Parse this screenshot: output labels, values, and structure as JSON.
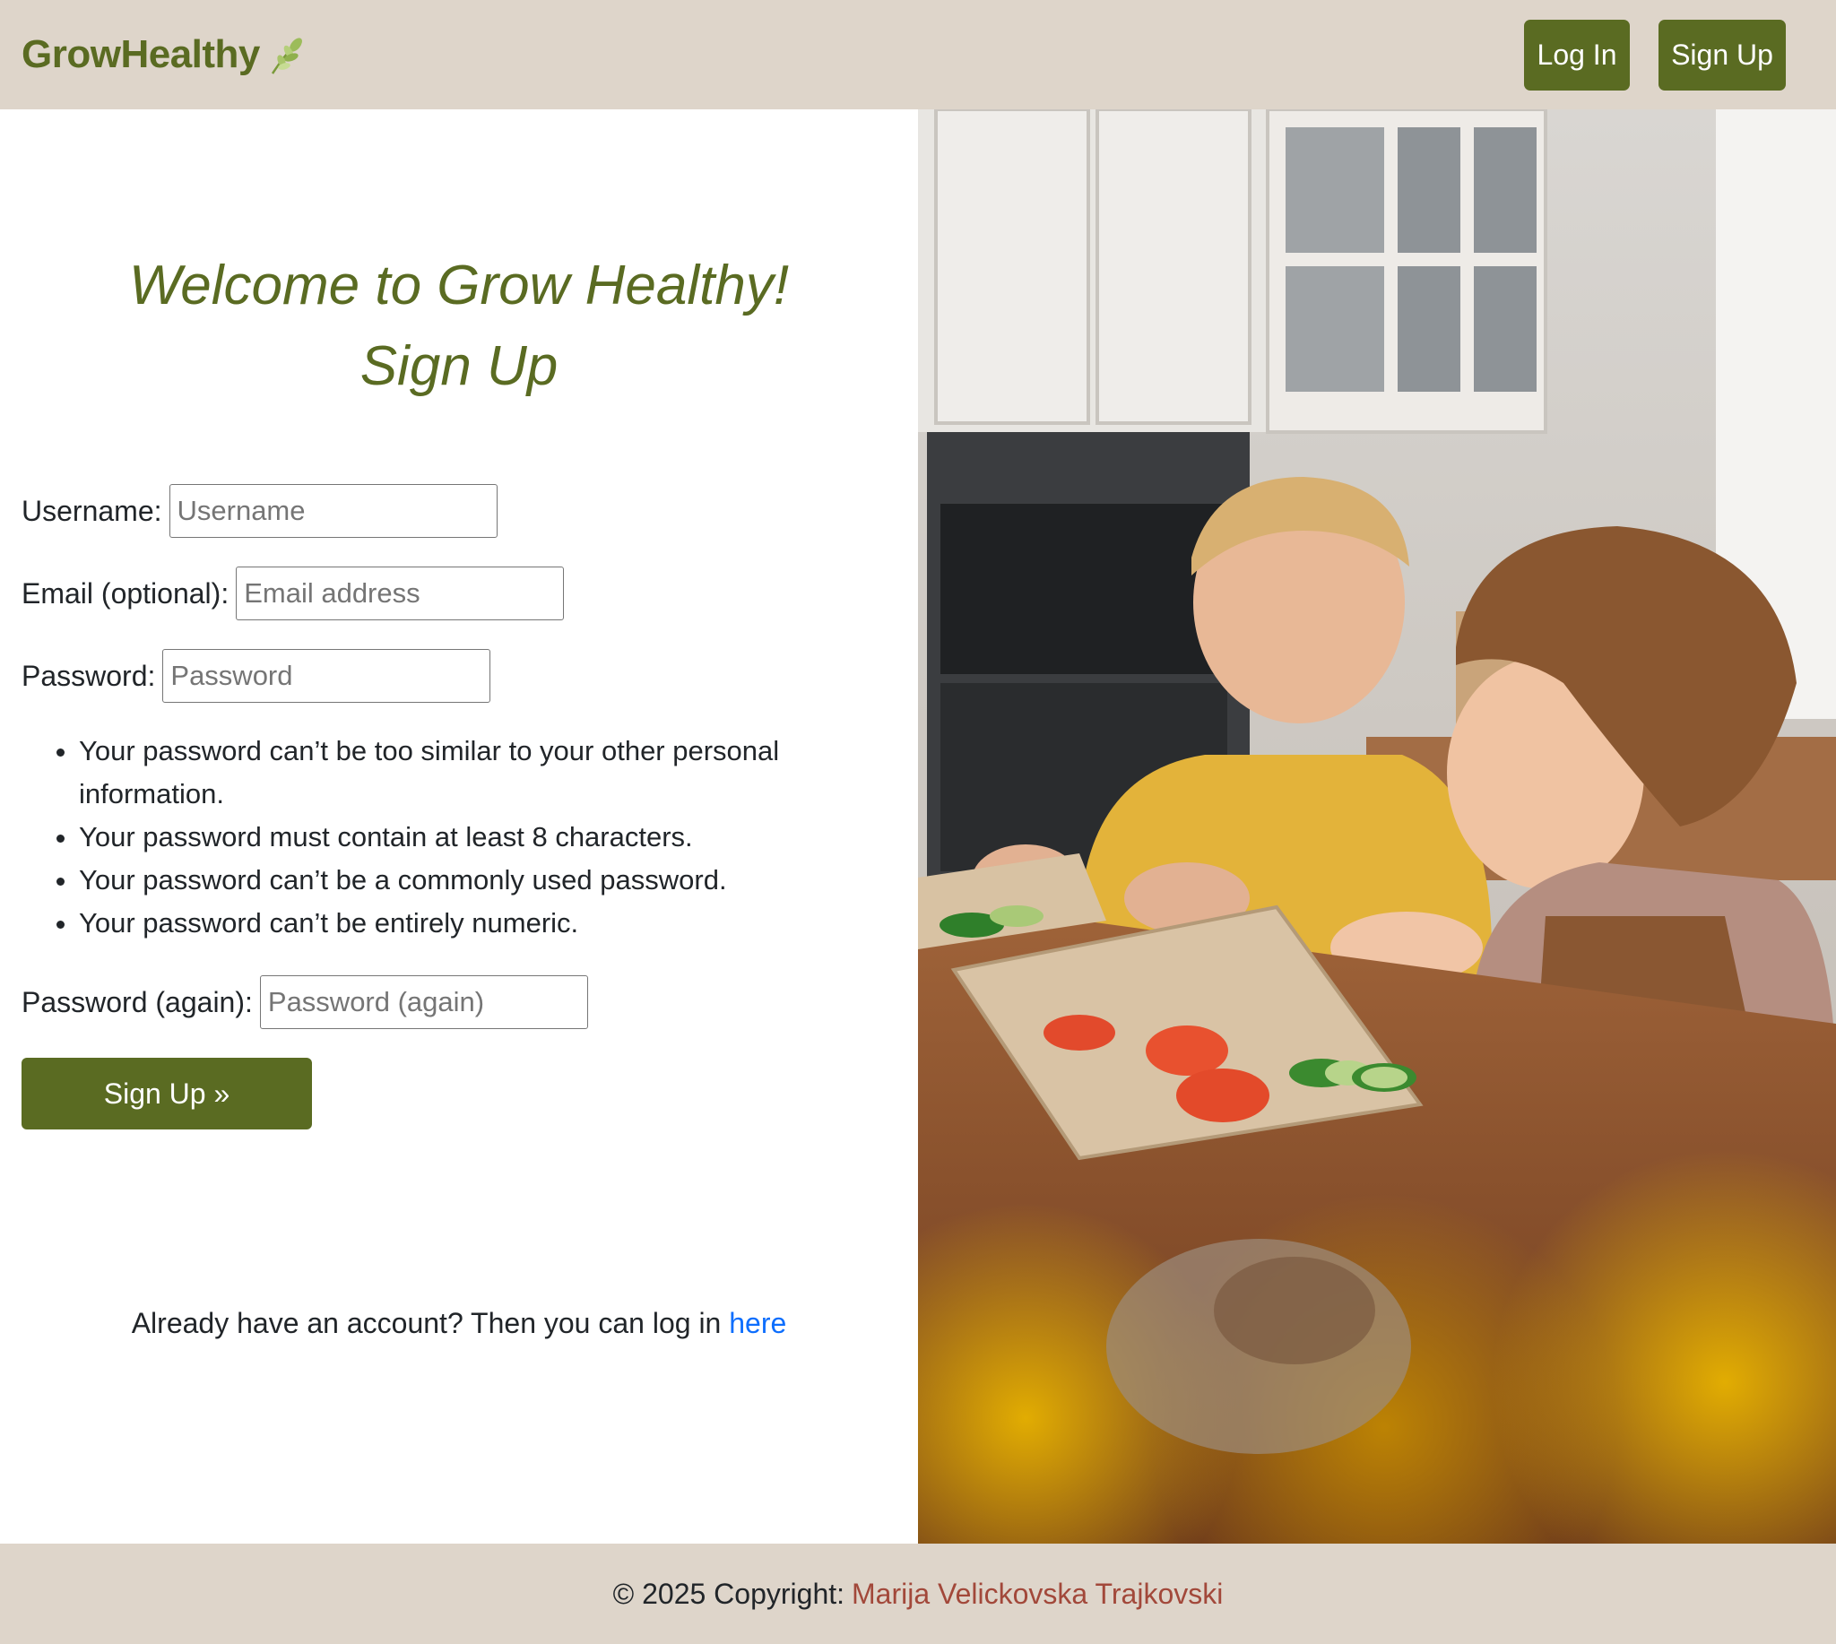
{
  "navbar": {
    "brand": "GrowHealthy",
    "brand_icon": "leaf-icon",
    "login_label": "Log In",
    "signup_label": "Sign Up"
  },
  "main": {
    "title_line1": "Welcome to Grow Healthy!",
    "title_line2": "Sign Up",
    "fields": {
      "username": {
        "label": "Username:",
        "placeholder": "Username",
        "value": ""
      },
      "email": {
        "label": "Email (optional):",
        "placeholder": "Email address",
        "value": ""
      },
      "password": {
        "label": "Password:",
        "placeholder": "Password",
        "value": ""
      },
      "password2": {
        "label": "Password (again):",
        "placeholder": "Password (again)",
        "value": ""
      }
    },
    "password_help": [
      "Your password can’t be too similar to your other personal information.",
      "Your password must contain at least 8 characters.",
      "Your password can’t be a commonly used password.",
      "Your password can’t be entirely numeric."
    ],
    "submit_label": "Sign Up »",
    "login_prompt": "Already have an account? Then you can log in ",
    "login_link": "here"
  },
  "hero": {
    "image": "kids-cooking-photo"
  },
  "footer": {
    "copyright": "© 2025 Copyright:",
    "author": "Marija Velickovska Trajkovski"
  },
  "colors": {
    "brand_green": "#5a6b22",
    "header_bg": "#ded5ca",
    "link_blue": "#0d6efd",
    "author_red": "#a2483a"
  }
}
